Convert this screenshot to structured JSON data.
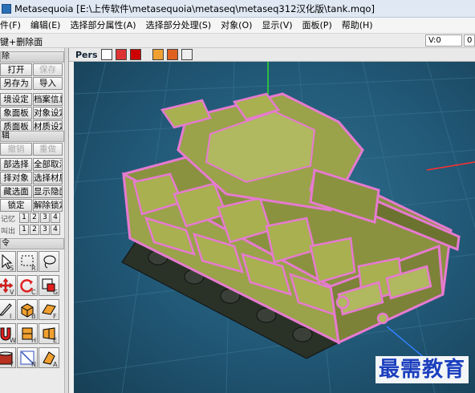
{
  "window": {
    "title": "Metasequoia [E:\\上传软件\\metasequoia\\metaseq\\metaseq312汉化版\\tank.mqo]"
  },
  "menu": [
    "件(F)",
    "编辑(E)",
    "选择部分属性(A)",
    "选择部分处理(S)",
    "对象(O)",
    "显示(V)",
    "面板(P)",
    "帮助(H)"
  ],
  "toolbar": {
    "hint": "键+删除面",
    "coord_label": "V:0",
    "coord2_label": "0"
  },
  "panel": {
    "file_section": "除",
    "open": "打开",
    "save": "保存",
    "save_as": "另存为",
    "import": "导入",
    "env_settings": "境设定",
    "file_info": "档案信息",
    "object_panel": "象面板",
    "object_settings": "对象设定",
    "material_panel": "质面板",
    "material_settings": "材质设定",
    "edit_section": "辑",
    "undo": "撤销",
    "redo": "重做",
    "select_all": "部选择",
    "deselect_all": "全部取消",
    "select_object": "择对象",
    "select_material": "选择材质",
    "hide_selected": "藏选面",
    "show_hidden": "显示隐面",
    "lock": "锁定",
    "unlock": "解除锁定",
    "memory_label": "记忆",
    "recall_label": "叫出",
    "memory_slots": [
      "1",
      "2",
      "3",
      "4"
    ],
    "recall_slots": [
      "1",
      "2",
      "3",
      "4"
    ],
    "tool_section": "令"
  },
  "tools": [
    {
      "name": "select-icon",
      "key": "S"
    },
    {
      "name": "rect-select-icon",
      "key": "R"
    },
    {
      "name": "lasso-icon",
      "key": ""
    },
    {
      "name": "move-icon",
      "key": "V"
    },
    {
      "name": "rotate-icon",
      "key": "C"
    },
    {
      "name": "scale-icon",
      "key": "G"
    },
    {
      "name": "knife-icon",
      "key": "I"
    },
    {
      "name": "box-icon",
      "key": "B"
    },
    {
      "name": "plane-icon",
      "key": "F"
    },
    {
      "name": "magnet-icon",
      "key": "W"
    },
    {
      "name": "face-icon",
      "key": "H"
    },
    {
      "name": "edge-icon",
      "key": "E"
    },
    {
      "name": "paint-icon",
      "key": "T"
    },
    {
      "name": "line-icon",
      "key": "N"
    },
    {
      "name": "bend-icon",
      "key": "A"
    }
  ],
  "viewport": {
    "view_label": "Pers"
  },
  "watermark": "最需教育",
  "colors": {
    "viewport_bg": "#215876",
    "grid_line": "#3c7896",
    "mesh_face": "#9aa24a",
    "wire_selected": "#e67ad0",
    "axis_x": "#ff3030",
    "axis_y": "#30dd30",
    "axis_z": "#3080ff"
  }
}
